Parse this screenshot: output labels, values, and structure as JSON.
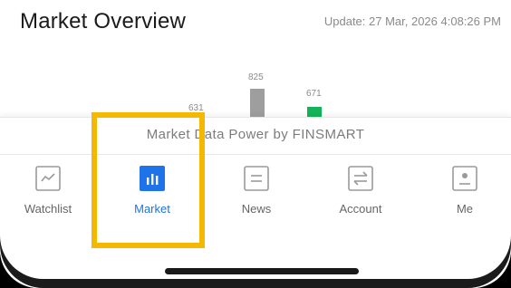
{
  "header": {
    "title": "Market Overview",
    "update": "Update: 27 Mar, 2026 4:08:26 PM"
  },
  "chart_data": {
    "type": "bar",
    "values": [
      631,
      825,
      671
    ],
    "labels": [
      "631",
      "825",
      "671"
    ],
    "colors": [
      "#9e9e9e",
      "#9e9e9e",
      "#13b457"
    ]
  },
  "footer": {
    "powered_by": "Market Data Power by FINSMART"
  },
  "tabs": [
    {
      "label": "Watchlist",
      "icon": "watchlist-chart-icon"
    },
    {
      "label": "Market",
      "icon": "market-bar-chart-icon",
      "active": true
    },
    {
      "label": "News",
      "icon": "news-icon"
    },
    {
      "label": "Account",
      "icon": "account-transfer-icon"
    },
    {
      "label": "Me",
      "icon": "profile-icon"
    }
  ],
  "colors": {
    "accent": "#1e73e8",
    "highlight": "#f5b800",
    "up": "#13b457"
  }
}
